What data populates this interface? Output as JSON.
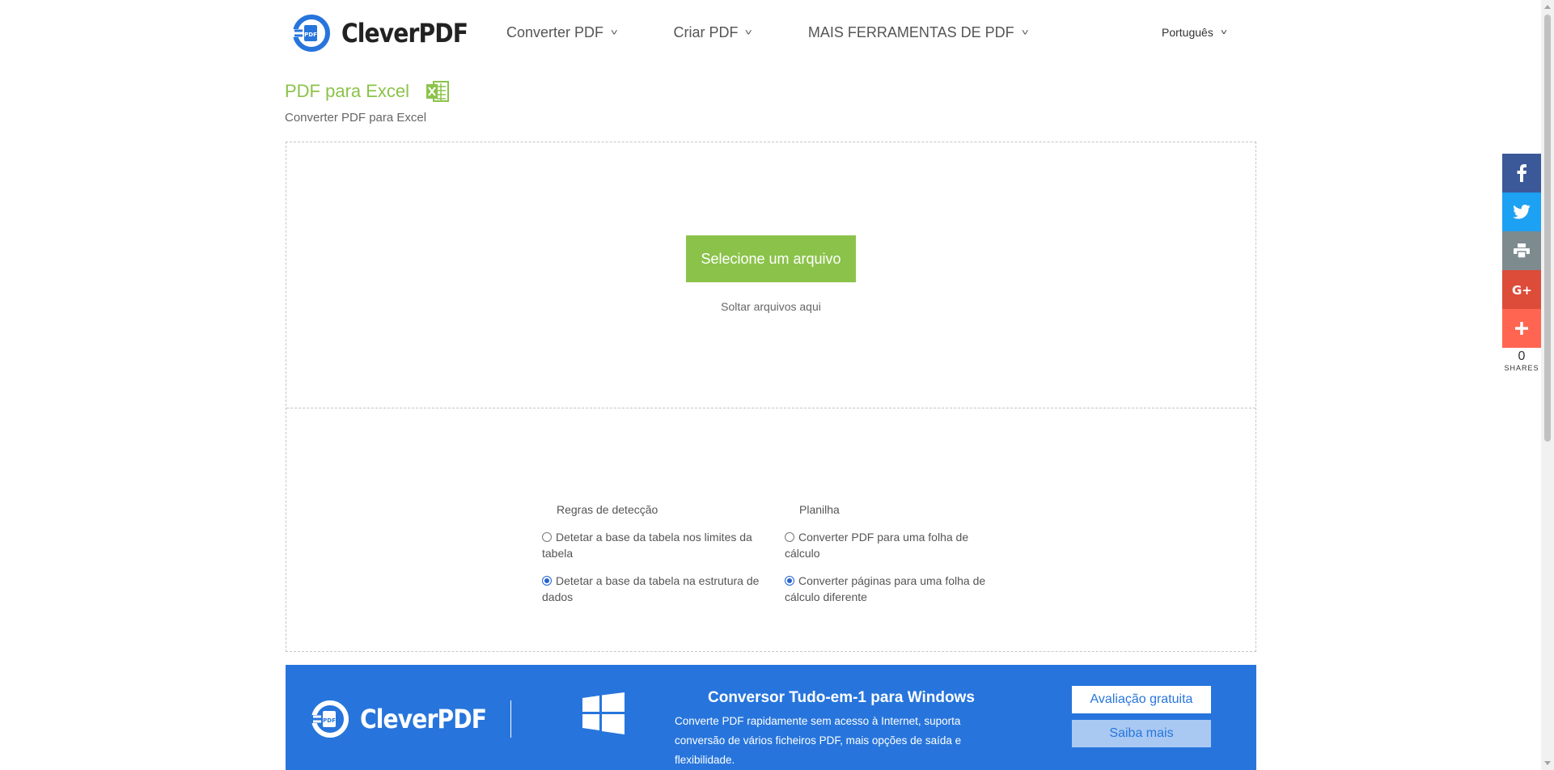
{
  "header": {
    "brand": "CleverPDF",
    "nav": [
      {
        "label": "Converter PDF"
      },
      {
        "label": "Criar PDF"
      },
      {
        "label": "MAIS FERRAMENTAS DE PDF"
      }
    ],
    "language": "Português"
  },
  "page": {
    "title": "PDF para Excel",
    "subtitle": "Converter PDF para Excel"
  },
  "upload": {
    "select_button": "Selecione um arquivo",
    "drop_hint": "Soltar arquivos aqui"
  },
  "options": {
    "detection": {
      "heading": "Regras de detecção",
      "items": [
        {
          "label": "Detetar a base da tabela nos limites da tabela",
          "checked": false
        },
        {
          "label": "Detetar a base da tabela na estrutura de dados",
          "checked": true
        }
      ]
    },
    "sheet": {
      "heading": "Planilha",
      "items": [
        {
          "label": "Converter PDF para uma folha de cálculo",
          "checked": false
        },
        {
          "label": "Converter páginas para uma folha de cálculo diferente",
          "checked": true
        }
      ]
    }
  },
  "banner": {
    "brand": "CleverPDF",
    "title": "Conversor Tudo-em-1 para Windows",
    "description": "Converte PDF rapidamente sem acesso à Internet, suporta conversão de vários ficheiros PDF, mais opções de saída e flexibilidade.",
    "trial_button": "Avaliação gratuita",
    "more_button": "Saiba mais"
  },
  "share": {
    "count": "0",
    "label": "SHARES",
    "buttons": [
      {
        "name": "facebook",
        "color": "#3b5998"
      },
      {
        "name": "twitter",
        "color": "#1da1f2"
      },
      {
        "name": "print",
        "color": "#7d8b8f"
      },
      {
        "name": "google-plus",
        "color": "#dd4b39"
      },
      {
        "name": "more",
        "color": "#ff6550"
      }
    ]
  },
  "colors": {
    "accent_green": "#8bc34a",
    "banner_blue": "#2775dc"
  }
}
